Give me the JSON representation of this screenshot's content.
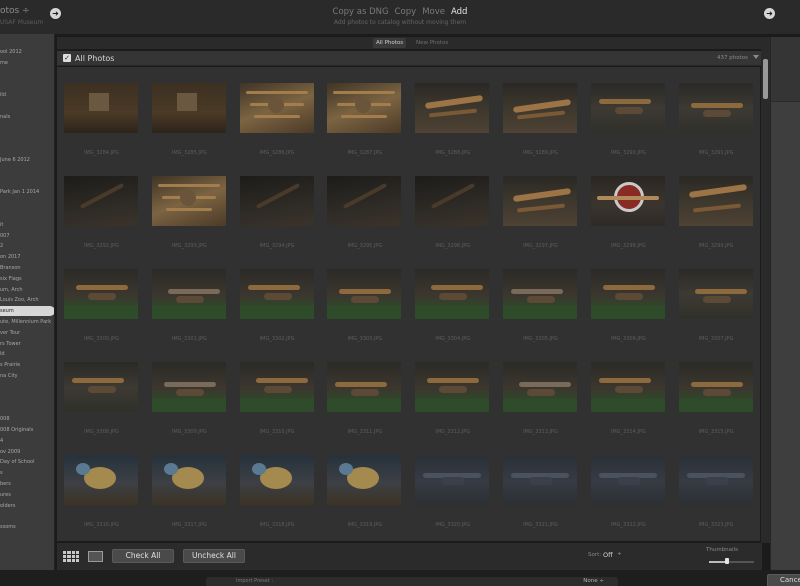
{
  "top": {
    "source_title": "otos ÷",
    "source_subtitle": "USAF Museum",
    "modes": [
      "Copy as DNG",
      "Copy",
      "Move",
      "Add"
    ],
    "active_mode": "Add",
    "mode_description": "Add photos to catalog without moving them"
  },
  "folders": [
    {
      "label": "ool 2012",
      "selected": false
    },
    {
      "label": "me",
      "selected": false
    },
    {
      "label": "",
      "selected": false
    },
    {
      "label": "",
      "selected": false
    },
    {
      "label": "ild",
      "selected": false
    },
    {
      "label": "",
      "selected": false
    },
    {
      "label": "nals",
      "selected": false
    },
    {
      "label": "",
      "selected": false
    },
    {
      "label": "",
      "selected": false
    },
    {
      "label": "",
      "selected": false
    },
    {
      "label": "June 6 2012",
      "selected": false
    },
    {
      "label": "",
      "selected": false
    },
    {
      "label": "",
      "selected": false
    },
    {
      "label": "Park Jan 1 2014",
      "selected": false
    },
    {
      "label": "",
      "selected": false
    },
    {
      "label": "",
      "selected": false
    },
    {
      "label": "it",
      "selected": false
    },
    {
      "label": "007",
      "selected": false
    },
    {
      "label": "2",
      "selected": false
    },
    {
      "label": "on 2017",
      "selected": false
    },
    {
      "label": "Branson",
      "selected": false
    },
    {
      "label": "six Flags",
      "selected": false
    },
    {
      "label": "um, Arch",
      "selected": false
    },
    {
      "label": "Louis Zoo, Arch",
      "selected": false
    },
    {
      "label": "seum",
      "selected": true
    },
    {
      "label": "ute, Millennium Park",
      "selected": false
    },
    {
      "label": "ver Tour",
      "selected": false
    },
    {
      "label": "rs Tower",
      "selected": false
    },
    {
      "label": "ld",
      "selected": false
    },
    {
      "label": "s Prairie",
      "selected": false
    },
    {
      "label": "na City",
      "selected": false
    },
    {
      "label": "",
      "selected": false
    },
    {
      "label": "",
      "selected": false
    },
    {
      "label": "",
      "selected": false
    },
    {
      "label": "008",
      "selected": false
    },
    {
      "label": "008 Originals",
      "selected": false
    },
    {
      "label": "4",
      "selected": false
    },
    {
      "label": "ov 2009",
      "selected": false
    },
    {
      "label": "Day of School",
      "selected": false
    },
    {
      "label": "s",
      "selected": false
    },
    {
      "label": "bers",
      "selected": false
    },
    {
      "label": "ures",
      "selected": false
    },
    {
      "label": "olders",
      "selected": false
    },
    {
      "label": "",
      "selected": false
    },
    {
      "label": "ssoms",
      "selected": false
    }
  ],
  "tabs": [
    {
      "label": "All Photos",
      "active": true
    },
    {
      "label": "New Photos",
      "active": false
    }
  ],
  "grid": {
    "title": "All Photos",
    "count": "437 photos",
    "checkbox": "✓",
    "photos": [
      {
        "name": "IMG_3284.JPG",
        "style": "wall"
      },
      {
        "name": "IMG_3285.JPG",
        "style": "wall"
      },
      {
        "name": "IMG_3286.JPG",
        "style": "frame"
      },
      {
        "name": "IMG_3287.JPG",
        "style": "frame"
      },
      {
        "name": "IMG_3288.JPG",
        "style": "wingr"
      },
      {
        "name": "IMG_3289.JPG",
        "style": "wingr"
      },
      {
        "name": "IMG_3290.JPG",
        "style": "hangar"
      },
      {
        "name": "IMG_3291.JPG",
        "style": "hangar"
      },
      {
        "name": "IMG_3292.JPG",
        "style": "dark"
      },
      {
        "name": "IMG_3293.JPG",
        "style": "frame"
      },
      {
        "name": "IMG_3294.JPG",
        "style": "dark"
      },
      {
        "name": "IMG_3295.JPG",
        "style": "dark"
      },
      {
        "name": "IMG_3296.JPG",
        "style": "dark"
      },
      {
        "name": "IMG_3297.JPG",
        "style": "wingr"
      },
      {
        "name": "IMG_3298.JPG",
        "style": "red"
      },
      {
        "name": "IMG_3299.JPG",
        "style": "wingr"
      },
      {
        "name": "IMG_3300.JPG",
        "style": "green"
      },
      {
        "name": "IMG_3301.JPG",
        "style": "green"
      },
      {
        "name": "IMG_3302.JPG",
        "style": "green"
      },
      {
        "name": "IMG_3303.JPG",
        "style": "green"
      },
      {
        "name": "IMG_3304.JPG",
        "style": "green"
      },
      {
        "name": "IMG_3305.JPG",
        "style": "green"
      },
      {
        "name": "IMG_3306.JPG",
        "style": "green"
      },
      {
        "name": "IMG_3307.JPG",
        "style": "hangar"
      },
      {
        "name": "IMG_3308.JPG",
        "style": "hangar"
      },
      {
        "name": "IMG_3309.JPG",
        "style": "green"
      },
      {
        "name": "IMG_3310.JPG",
        "style": "green"
      },
      {
        "name": "IMG_3311.JPG",
        "style": "green"
      },
      {
        "name": "IMG_3312.JPG",
        "style": "green"
      },
      {
        "name": "IMG_3313.JPG",
        "style": "green"
      },
      {
        "name": "IMG_3314.JPG",
        "style": "green"
      },
      {
        "name": "IMG_3315.JPG",
        "style": "green"
      },
      {
        "name": "IMG_3316.JPG",
        "style": "bird"
      },
      {
        "name": "IMG_3317.JPG",
        "style": "bird"
      },
      {
        "name": "IMG_3318.JPG",
        "style": "bird"
      },
      {
        "name": "IMG_3319.JPG",
        "style": "bird"
      },
      {
        "name": "IMG_3320.JPG",
        "style": "blue"
      },
      {
        "name": "IMG_3321.JPG",
        "style": "blue"
      },
      {
        "name": "IMG_3322.JPG",
        "style": "blue"
      },
      {
        "name": "IMG_3323.JPG",
        "style": "blue"
      }
    ]
  },
  "toolbar": {
    "check_all": "Check All",
    "uncheck_all": "Uncheck All",
    "sort_label": "Sort:",
    "sort_value": "Off",
    "sort_chevron": "÷",
    "thumbnails_label": "Thumbnails",
    "thumbnail_size": 0.4
  },
  "bottom": {
    "import_preset_label": "Import Preset :",
    "import_preset_value": "None ÷",
    "cancel": "Cancel"
  },
  "icons": {
    "nav_left": "circle-arrow-right-icon",
    "nav_right": "circle-arrow-right-icon",
    "grid_view": "grid-view-icon",
    "loupe_view": "loupe-view-icon"
  }
}
